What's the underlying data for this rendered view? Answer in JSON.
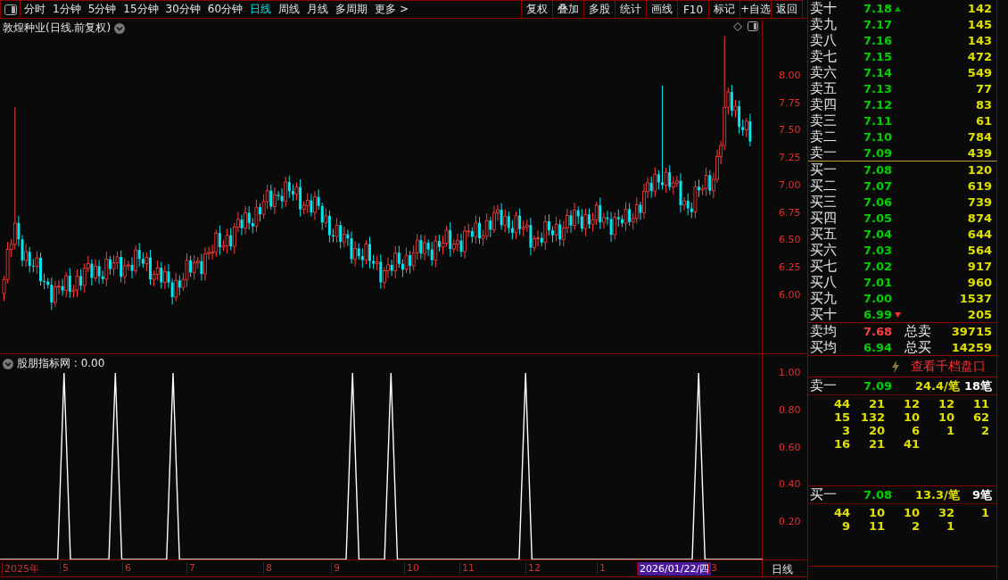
{
  "toolbar": {
    "periods": [
      {
        "label": "分时",
        "selected": false
      },
      {
        "label": "1分钟",
        "selected": false
      },
      {
        "label": "5分钟",
        "selected": false
      },
      {
        "label": "15分钟",
        "selected": false
      },
      {
        "label": "30分钟",
        "selected": false
      },
      {
        "label": "60分钟",
        "selected": false
      },
      {
        "label": "日线",
        "selected": true
      },
      {
        "label": "周线",
        "selected": false
      },
      {
        "label": "月线",
        "selected": false
      },
      {
        "label": "多周期",
        "selected": false
      },
      {
        "label": "更多 >",
        "selected": false
      }
    ],
    "buttons": [
      "复权",
      "叠加",
      "多股",
      "统计",
      "画线",
      "F10",
      "标记",
      "+自选",
      "返回"
    ]
  },
  "price_panel": {
    "title": "敦煌种业(日线.前复权)",
    "axis": [
      "8.00",
      "7.75",
      "7.50",
      "7.25",
      "7.00",
      "6.75",
      "6.50",
      "6.25",
      "6.00"
    ]
  },
  "indicator_panel": {
    "title": "股朋指标网 : 0.00",
    "axis": [
      "1.00",
      "0.80",
      "0.60",
      "0.40",
      "0.20"
    ]
  },
  "time_axis": {
    "labels": [
      {
        "label": "2025年",
        "selected": false
      },
      {
        "label": "5",
        "selected": false
      },
      {
        "label": "6",
        "selected": false
      },
      {
        "label": "7",
        "selected": false
      },
      {
        "label": "8",
        "selected": false
      },
      {
        "label": "9",
        "selected": false
      },
      {
        "label": "10",
        "selected": false
      },
      {
        "label": "11",
        "selected": false
      },
      {
        "label": "12",
        "selected": false
      },
      {
        "label": "1",
        "selected": false
      },
      {
        "label": "2026/01/22/四",
        "selected": true
      },
      {
        "label": "3",
        "selected": false
      }
    ],
    "period": "日线"
  },
  "order_book": {
    "asks": [
      {
        "label": "卖十",
        "price": "7.18",
        "volume": "142",
        "mark_up": true,
        "mark_down": false
      },
      {
        "label": "卖九",
        "price": "7.17",
        "volume": "145",
        "mark_up": false,
        "mark_down": false
      },
      {
        "label": "卖八",
        "price": "7.16",
        "volume": "143",
        "mark_up": false,
        "mark_down": false
      },
      {
        "label": "卖七",
        "price": "7.15",
        "volume": "472",
        "mark_up": false,
        "mark_down": false
      },
      {
        "label": "卖六",
        "price": "7.14",
        "volume": "549",
        "mark_up": false,
        "mark_down": false
      },
      {
        "label": "卖五",
        "price": "7.13",
        "volume": "77",
        "mark_up": false,
        "mark_down": false
      },
      {
        "label": "卖四",
        "price": "7.12",
        "volume": "83",
        "mark_up": false,
        "mark_down": false
      },
      {
        "label": "卖三",
        "price": "7.11",
        "volume": "61",
        "mark_up": false,
        "mark_down": false
      },
      {
        "label": "卖二",
        "price": "7.10",
        "volume": "784",
        "mark_up": false,
        "mark_down": false
      },
      {
        "label": "卖一",
        "price": "7.09",
        "volume": "439",
        "mark_up": false,
        "mark_down": false
      }
    ],
    "bids": [
      {
        "label": "买一",
        "price": "7.08",
        "volume": "120",
        "mark_up": false,
        "mark_down": false
      },
      {
        "label": "买二",
        "price": "7.07",
        "volume": "619",
        "mark_up": false,
        "mark_down": false
      },
      {
        "label": "买三",
        "price": "7.06",
        "volume": "739",
        "mark_up": false,
        "mark_down": false
      },
      {
        "label": "买四",
        "price": "7.05",
        "volume": "874",
        "mark_up": false,
        "mark_down": false
      },
      {
        "label": "买五",
        "price": "7.04",
        "volume": "644",
        "mark_up": false,
        "mark_down": false
      },
      {
        "label": "买六",
        "price": "7.03",
        "volume": "564",
        "mark_up": false,
        "mark_down": false
      },
      {
        "label": "买七",
        "price": "7.02",
        "volume": "917",
        "mark_up": false,
        "mark_down": false
      },
      {
        "label": "买八",
        "price": "7.01",
        "volume": "960",
        "mark_up": false,
        "mark_down": false
      },
      {
        "label": "买九",
        "price": "7.00",
        "volume": "1537",
        "mark_up": false,
        "mark_down": false
      },
      {
        "label": "买十",
        "price": "6.99",
        "volume": "205",
        "mark_up": false,
        "mark_down": true
      }
    ],
    "summary": [
      {
        "label": "卖均",
        "price": "7.68",
        "rising": true,
        "total_label": "总卖",
        "total": "39715"
      },
      {
        "label": "买均",
        "price": "6.94",
        "rising": false,
        "total_label": "总买",
        "total": "14259"
      }
    ],
    "depth_link": "查看千档盘口",
    "queues": [
      {
        "label": "卖一",
        "price": "7.09",
        "average": "24.4/笔",
        "count": "18笔",
        "orders": [
          [
            "44",
            "21",
            "12",
            "12",
            "11"
          ],
          [
            "15",
            "132",
            "10",
            "10",
            "62"
          ],
          [
            "3",
            "20",
            "6",
            "1",
            "2"
          ],
          [
            "16",
            "21",
            "41"
          ]
        ]
      },
      {
        "label": "买一",
        "price": "7.08",
        "average": "13.3/笔",
        "count": "9笔",
        "orders": [
          [
            "44",
            "10",
            "10",
            "32",
            "1"
          ],
          [
            "9",
            "11",
            "2",
            "1"
          ]
        ]
      }
    ]
  }
}
